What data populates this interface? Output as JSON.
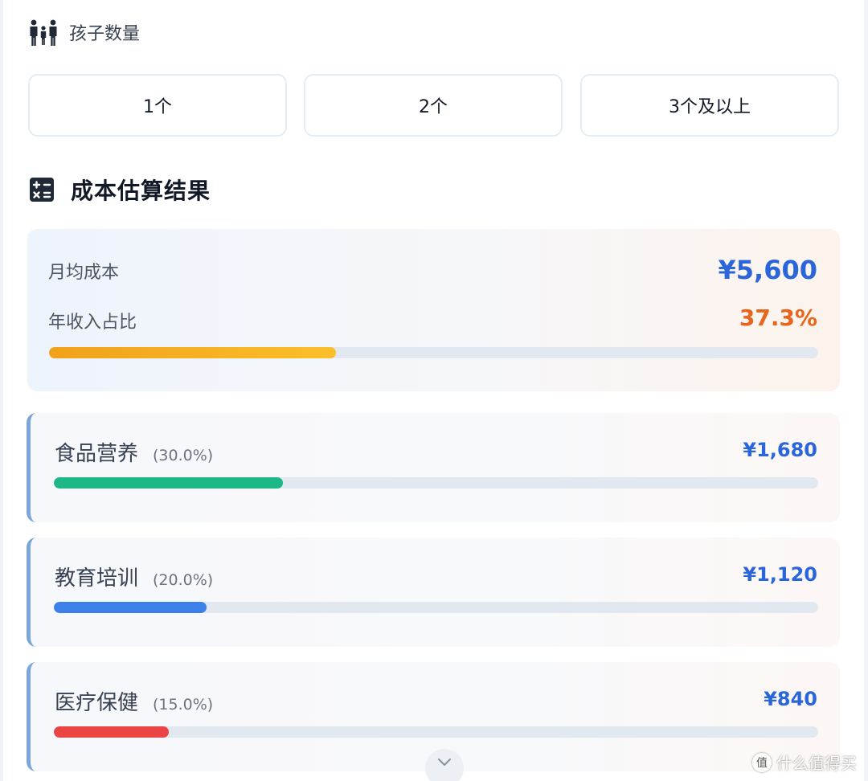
{
  "kids_section": {
    "title": "孩子数量",
    "options": [
      "1个",
      "2个",
      "3个及以上"
    ]
  },
  "results_section": {
    "title": "成本估算结果",
    "summary": {
      "monthly_label": "月均成本",
      "monthly_value": "¥5,600",
      "ratio_label": "年收入占比",
      "ratio_value": "37.3%",
      "ratio_fraction": 0.373
    },
    "categories": [
      {
        "name": "食品营养",
        "percent": "(30.0%)",
        "amount": "¥1,680",
        "fraction": 0.3,
        "color": "#1db886"
      },
      {
        "name": "教育培训",
        "percent": "(20.0%)",
        "amount": "¥1,120",
        "fraction": 0.2,
        "color": "#3d80ea"
      },
      {
        "name": "医疗保健",
        "percent": "(15.0%)",
        "amount": "¥840",
        "fraction": 0.15,
        "color": "#ea4444"
      }
    ]
  },
  "colors": {
    "accent_blue": "#2a66d9",
    "ratio_orange": "#e8651e",
    "category_border": "#7aa7d8"
  },
  "icons": {
    "kids": "family-icon",
    "results": "calculator-icon",
    "scroll": "chevron-down-icon",
    "watermark": "smzdm-logo-icon"
  },
  "watermark": {
    "badge": "值",
    "text": "什么值得买"
  }
}
